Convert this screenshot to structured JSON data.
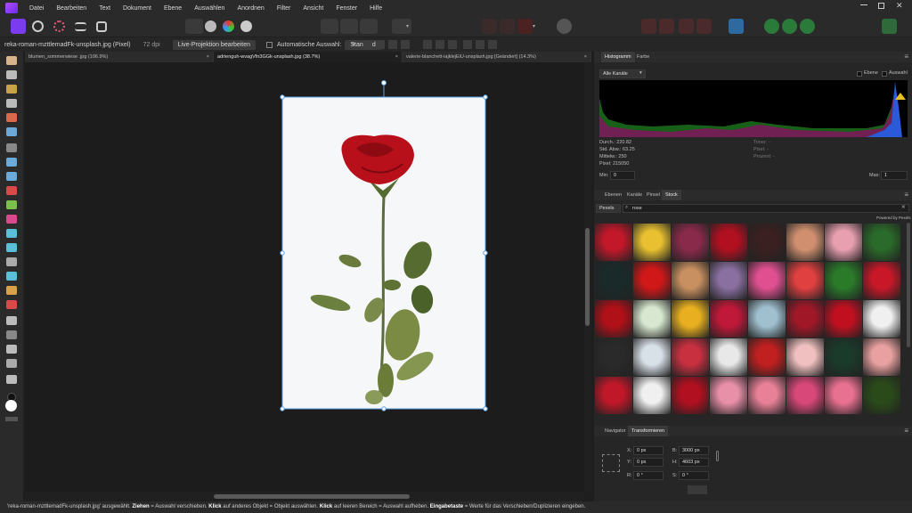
{
  "menu": [
    "Datei",
    "Bearbeiten",
    "Text",
    "Dokument",
    "Ebene",
    "Auswählen",
    "Anordnen",
    "Filter",
    "Ansicht",
    "Fenster",
    "Hilfe"
  ],
  "context": {
    "filename": "reka-roman-mzttlemadFk-unsplash.jpg (Pixel)",
    "dpi": "72 dpi",
    "live_projection": "Live-Projektion bearbeiten",
    "auto_select": "Automatische Auswahl:",
    "auto_select_value": "Standard"
  },
  "tabs": [
    {
      "label": "blumen_sommerwiese .jpg (106.9%)"
    },
    {
      "label": "adrienguh-wvagVfn3GGk-unsplash.jpg (38.7%)"
    },
    {
      "label": "valerie-blanchett-iajklejEiU-unsplash.jpg [Geändert] (14.3%)"
    }
  ],
  "histogram": {
    "tab_active": "Histogramm",
    "tab_other": "Farbe",
    "channel": "Alle Kanäle",
    "opt1": "Ebene",
    "opt2": "Auswahl",
    "stats_left": [
      "Durch.: 220.82",
      "Std. Abw.: 63.25",
      "Mittelw.: 250",
      "Pixel: 215050"
    ],
    "stats_right": [
      "Toner: -",
      "Pixel: -",
      "Prozent: -"
    ],
    "min_label": "Min:",
    "min_value": "0",
    "max_label": "Max:",
    "max_value": "1"
  },
  "stock": {
    "tabs": [
      "Ebenen",
      "Kanäle",
      "Pinsel",
      "Stock"
    ],
    "provider": "Pexels",
    "search_value": "rose",
    "powered": "Powered by Pexels"
  },
  "transform": {
    "tabs": [
      "Navigator",
      "Transformieren"
    ],
    "x_label": "X:",
    "x_value": "0 px",
    "y_label": "Y:",
    "y_value": "0 px",
    "b_label": "B:",
    "b_value": "3000 px",
    "h_label": "H:",
    "h_value": "4603 px",
    "r_label": "R:",
    "r_value": "0 °",
    "s_label": "S:",
    "s_value": "0 °"
  },
  "status": {
    "part1": "'reka-roman-mzttlemadFk-unsplash.jpg' ausgewählt.",
    "b1": "Ziehen",
    "part2": "= Auswahl verschieben.",
    "b2": "Klick",
    "part3": "auf anderes Objekt = Objekt auswählen.",
    "b3": "Klick",
    "part4": "auf leeren Bereich = Auswahl aufheben.",
    "b4": "Eingabetaste",
    "part5": "= Werte für das Verschieben/Duplizieren eingeben."
  },
  "colors": {
    "accent": "#7b3cf0",
    "panel": "#262626",
    "selection": "#5aa0e6"
  }
}
